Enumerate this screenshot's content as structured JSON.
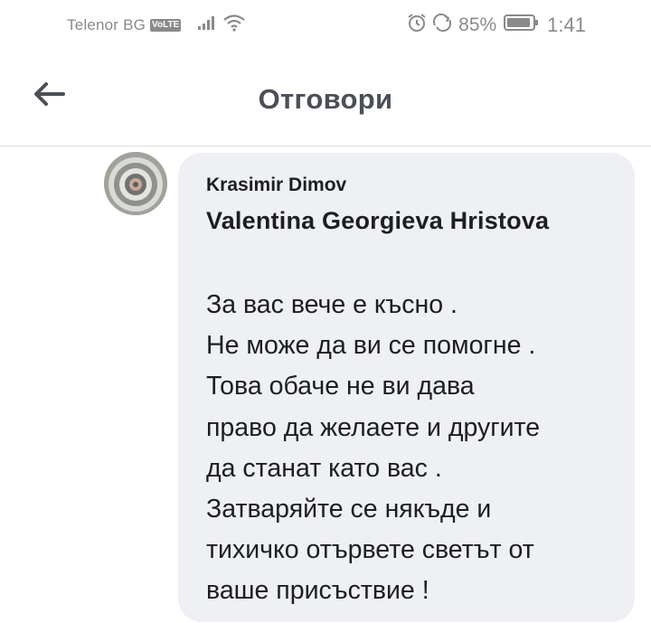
{
  "status_bar": {
    "carrier": "Telenor BG",
    "volte": "VoLTE",
    "battery_percent": "85%",
    "time": "1:41",
    "icons": [
      "signal-icon",
      "wifi-icon",
      "alarm-icon",
      "rotation-icon",
      "battery-icon"
    ]
  },
  "header": {
    "title": "Отговори",
    "back_icon": "arrow-left-icon"
  },
  "comment": {
    "author": "Krasimir Dimov",
    "mention": "Valentina Georgieva Hristova",
    "lines": [
      "За вас вече е късно .",
      "Не може да ви се помогне .",
      "Това обаче не ви дава",
      "право да желаете и другите",
      "да станат като вас .",
      "Затваряйте се някъде и",
      "тихичко отървете светът от",
      "ваше присъствие !"
    ]
  },
  "colors": {
    "bubble_background": "#eff0f4",
    "title_color": "#4b4f56",
    "status_bar_text": "#8a8a8a",
    "divider": "#dadde1"
  }
}
